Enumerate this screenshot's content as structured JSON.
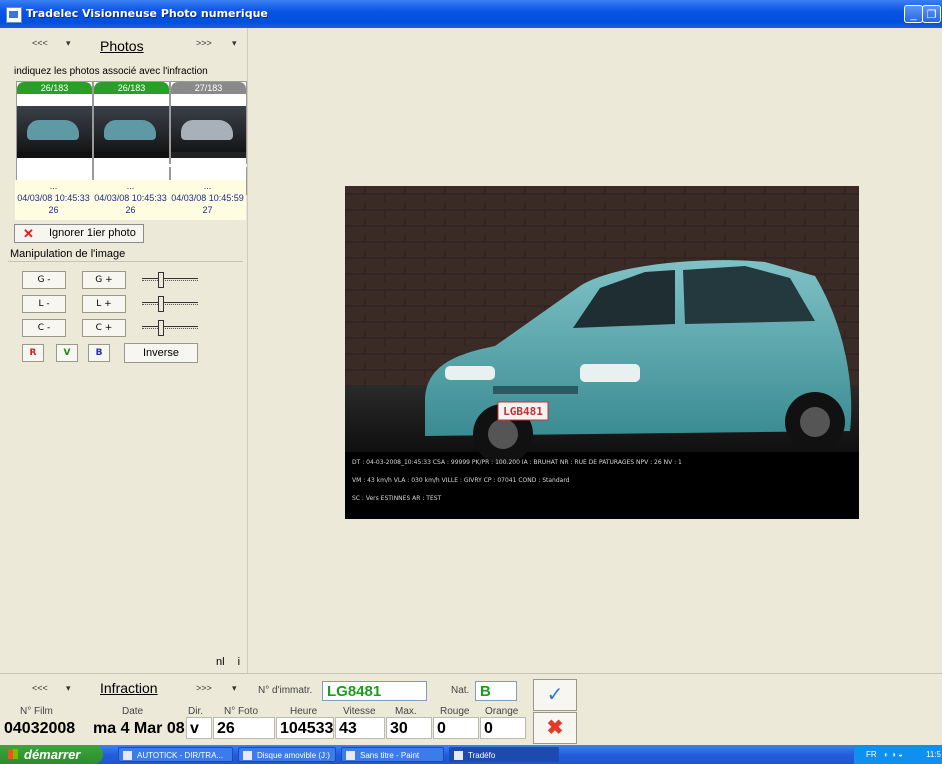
{
  "window": {
    "title": "Tradelec Visionneuse Photo numerique"
  },
  "photos": {
    "prev": "<<<",
    "prev_arrow": "▾",
    "title": "Photos",
    "next": ">>>",
    "next_arrow": "▾",
    "hint": "indiquez les photos associé avec l'infraction",
    "thumbs": [
      {
        "label": "26/183",
        "status": "green"
      },
      {
        "label": "26/183",
        "status": "green"
      },
      {
        "label": "27/183",
        "status": "grey"
      }
    ],
    "details": [
      {
        "dots": "...",
        "datetime": "04/03/08 10:45:33",
        "num": "26"
      },
      {
        "dots": "...",
        "datetime": "04/03/08 10:45:33",
        "num": "26"
      },
      {
        "dots": "...",
        "datetime": "04/03/08 10:45:59",
        "num": "27"
      }
    ],
    "ignore_label": "Ignorer 1ier photo",
    "ignore_icon": "✕"
  },
  "manipulation": {
    "title": "Manipulation de l'image",
    "rows": [
      {
        "minus": "G -",
        "plus": "G +"
      },
      {
        "minus": "L -",
        "plus": "L +"
      },
      {
        "minus": "C -",
        "plus": "C +"
      }
    ],
    "r": "R",
    "v": "V",
    "b": "B",
    "inverse": "Inverse",
    "colors": {
      "r": "#d21e1e",
      "v": "#1d8a1d",
      "b": "#1f2fb8"
    }
  },
  "footer_left": {
    "nl": "nl",
    "i": "i"
  },
  "image_caption": {
    "line1": "DT : 04-03-2008_10:45:33  CSA : 99999  PK/PR : 100.200  IA : BRUHAT  NR : RUE DE PATURAGES  NPV : 26  NV : 1",
    "line2": "VM : 43 km/h   VLA : 030 km/h   VILLE : GIVRY  CP : 07041  COND : Standard",
    "line3": "SC : Vers ESTINNES  AR : TEST",
    "plate_on_car": "LGB481"
  },
  "infraction": {
    "prev": "<<<",
    "prev_arrow": "▾",
    "title": "Infraction",
    "next": ">>>",
    "next_arrow": "▾",
    "plate_label": "N° d'immatr.",
    "plate_value": "LG8481",
    "nat_label": "Nat.",
    "nat_value": "B",
    "ok_icon": "✓",
    "cancel_icon": "✖",
    "labels": {
      "film": "N° Film",
      "date": "Date",
      "dir": "Dir.",
      "foto": "N° Foto",
      "heure": "Heure",
      "vitesse": "Vitesse",
      "max": "Max.",
      "rouge": "Rouge",
      "orange": "Orange"
    },
    "values": {
      "film": "04032008",
      "date": "ma 4 Mar 08",
      "dir": "v",
      "foto": "26",
      "heure": "104533",
      "vitesse": "43",
      "max": "30",
      "rouge": "0",
      "orange": "0"
    }
  },
  "taskbar": {
    "start": "démarrer",
    "tasks": [
      {
        "label": "AUTOTICK - DIR/TRA..."
      },
      {
        "label": "Disque amovible (J:)"
      },
      {
        "label": "Sans titre - Paint"
      },
      {
        "label": "Tradéfo"
      }
    ],
    "tray": {
      "lang": "FR",
      "time": "11:5"
    }
  }
}
